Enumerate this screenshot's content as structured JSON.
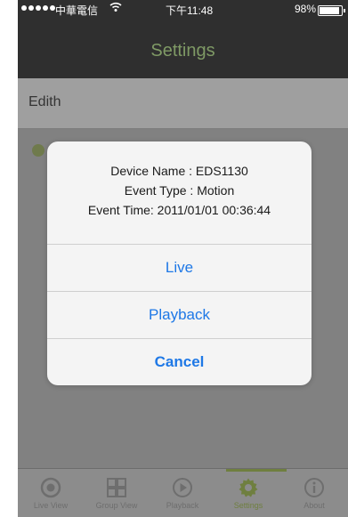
{
  "status_bar": {
    "carrier": "中華電信",
    "time": "下午11:48",
    "battery": "98%"
  },
  "nav": {
    "title": "Settings"
  },
  "section": {
    "label": "Edith"
  },
  "alert": {
    "lines": [
      "Device Name : EDS1130",
      "Event Type : Motion",
      "Event Time: 2011/01/01 00:36:44"
    ],
    "buttons": {
      "live": "Live",
      "playback": "Playback",
      "cancel": "Cancel"
    }
  },
  "tabbar": {
    "tabs": [
      {
        "label": "Live View",
        "icon": "live-view-icon"
      },
      {
        "label": "Group View",
        "icon": "group-view-icon"
      },
      {
        "label": "Playback",
        "icon": "playback-icon"
      },
      {
        "label": "Settings",
        "icon": "settings-icon",
        "active": true
      },
      {
        "label": "About",
        "icon": "about-icon"
      }
    ]
  },
  "colors": {
    "accent": "#6f7f3f",
    "link": "#1e78e6",
    "header": "#2f2f2f"
  }
}
